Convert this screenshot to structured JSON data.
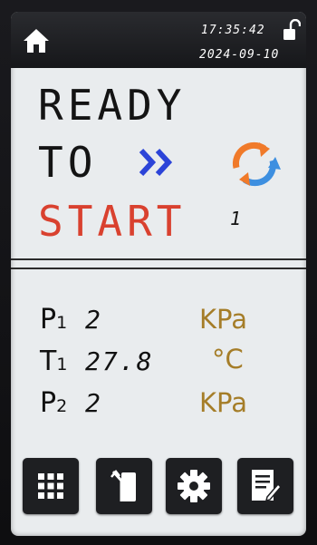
{
  "topbar": {
    "time": "17:35:42",
    "date": "2024-09-10",
    "lock_state": "unlocked"
  },
  "status": {
    "line1": "READY",
    "line2": "TO",
    "line3": "START",
    "count": "1"
  },
  "params": [
    {
      "label": "P",
      "sub": "1",
      "value": "2",
      "unit": "KPa"
    },
    {
      "label": "T",
      "sub": "1",
      "value": "27.8",
      "unit": "°C"
    },
    {
      "label": "P",
      "sub": "2",
      "value": "2",
      "unit": "KPa"
    }
  ],
  "toolbar": {
    "buttons": [
      "grid-menu-icon",
      "door-exit-icon",
      "gear-icon",
      "report-icon"
    ]
  },
  "colors": {
    "start_red": "#d9412f",
    "unit_gold": "#a57d28",
    "chevron_blue": "#2c44d8",
    "refresh_orange": "#f07a2a",
    "refresh_blue": "#3d8fe0"
  }
}
